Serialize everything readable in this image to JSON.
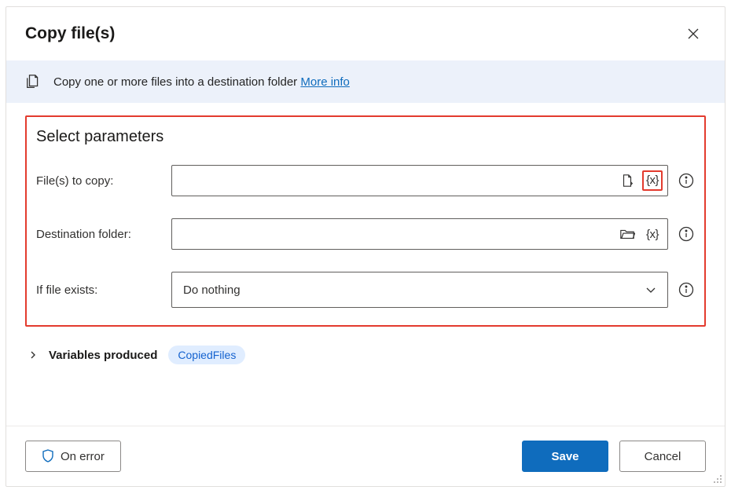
{
  "title": "Copy file(s)",
  "info_bar": {
    "text": "Copy one or more files into a destination folder",
    "more_info_label": "More info"
  },
  "section_title": "Select parameters",
  "params": {
    "files_label": "File(s) to copy:",
    "files_value": "",
    "dest_label": "Destination folder:",
    "dest_value": "",
    "exists_label": "If file exists:",
    "exists_value": "Do nothing"
  },
  "variables": {
    "label": "Variables produced",
    "pill": "CopiedFiles"
  },
  "buttons": {
    "on_error": "On error",
    "save": "Save",
    "cancel": "Cancel"
  },
  "icons": {
    "var_brace": "{x}"
  }
}
